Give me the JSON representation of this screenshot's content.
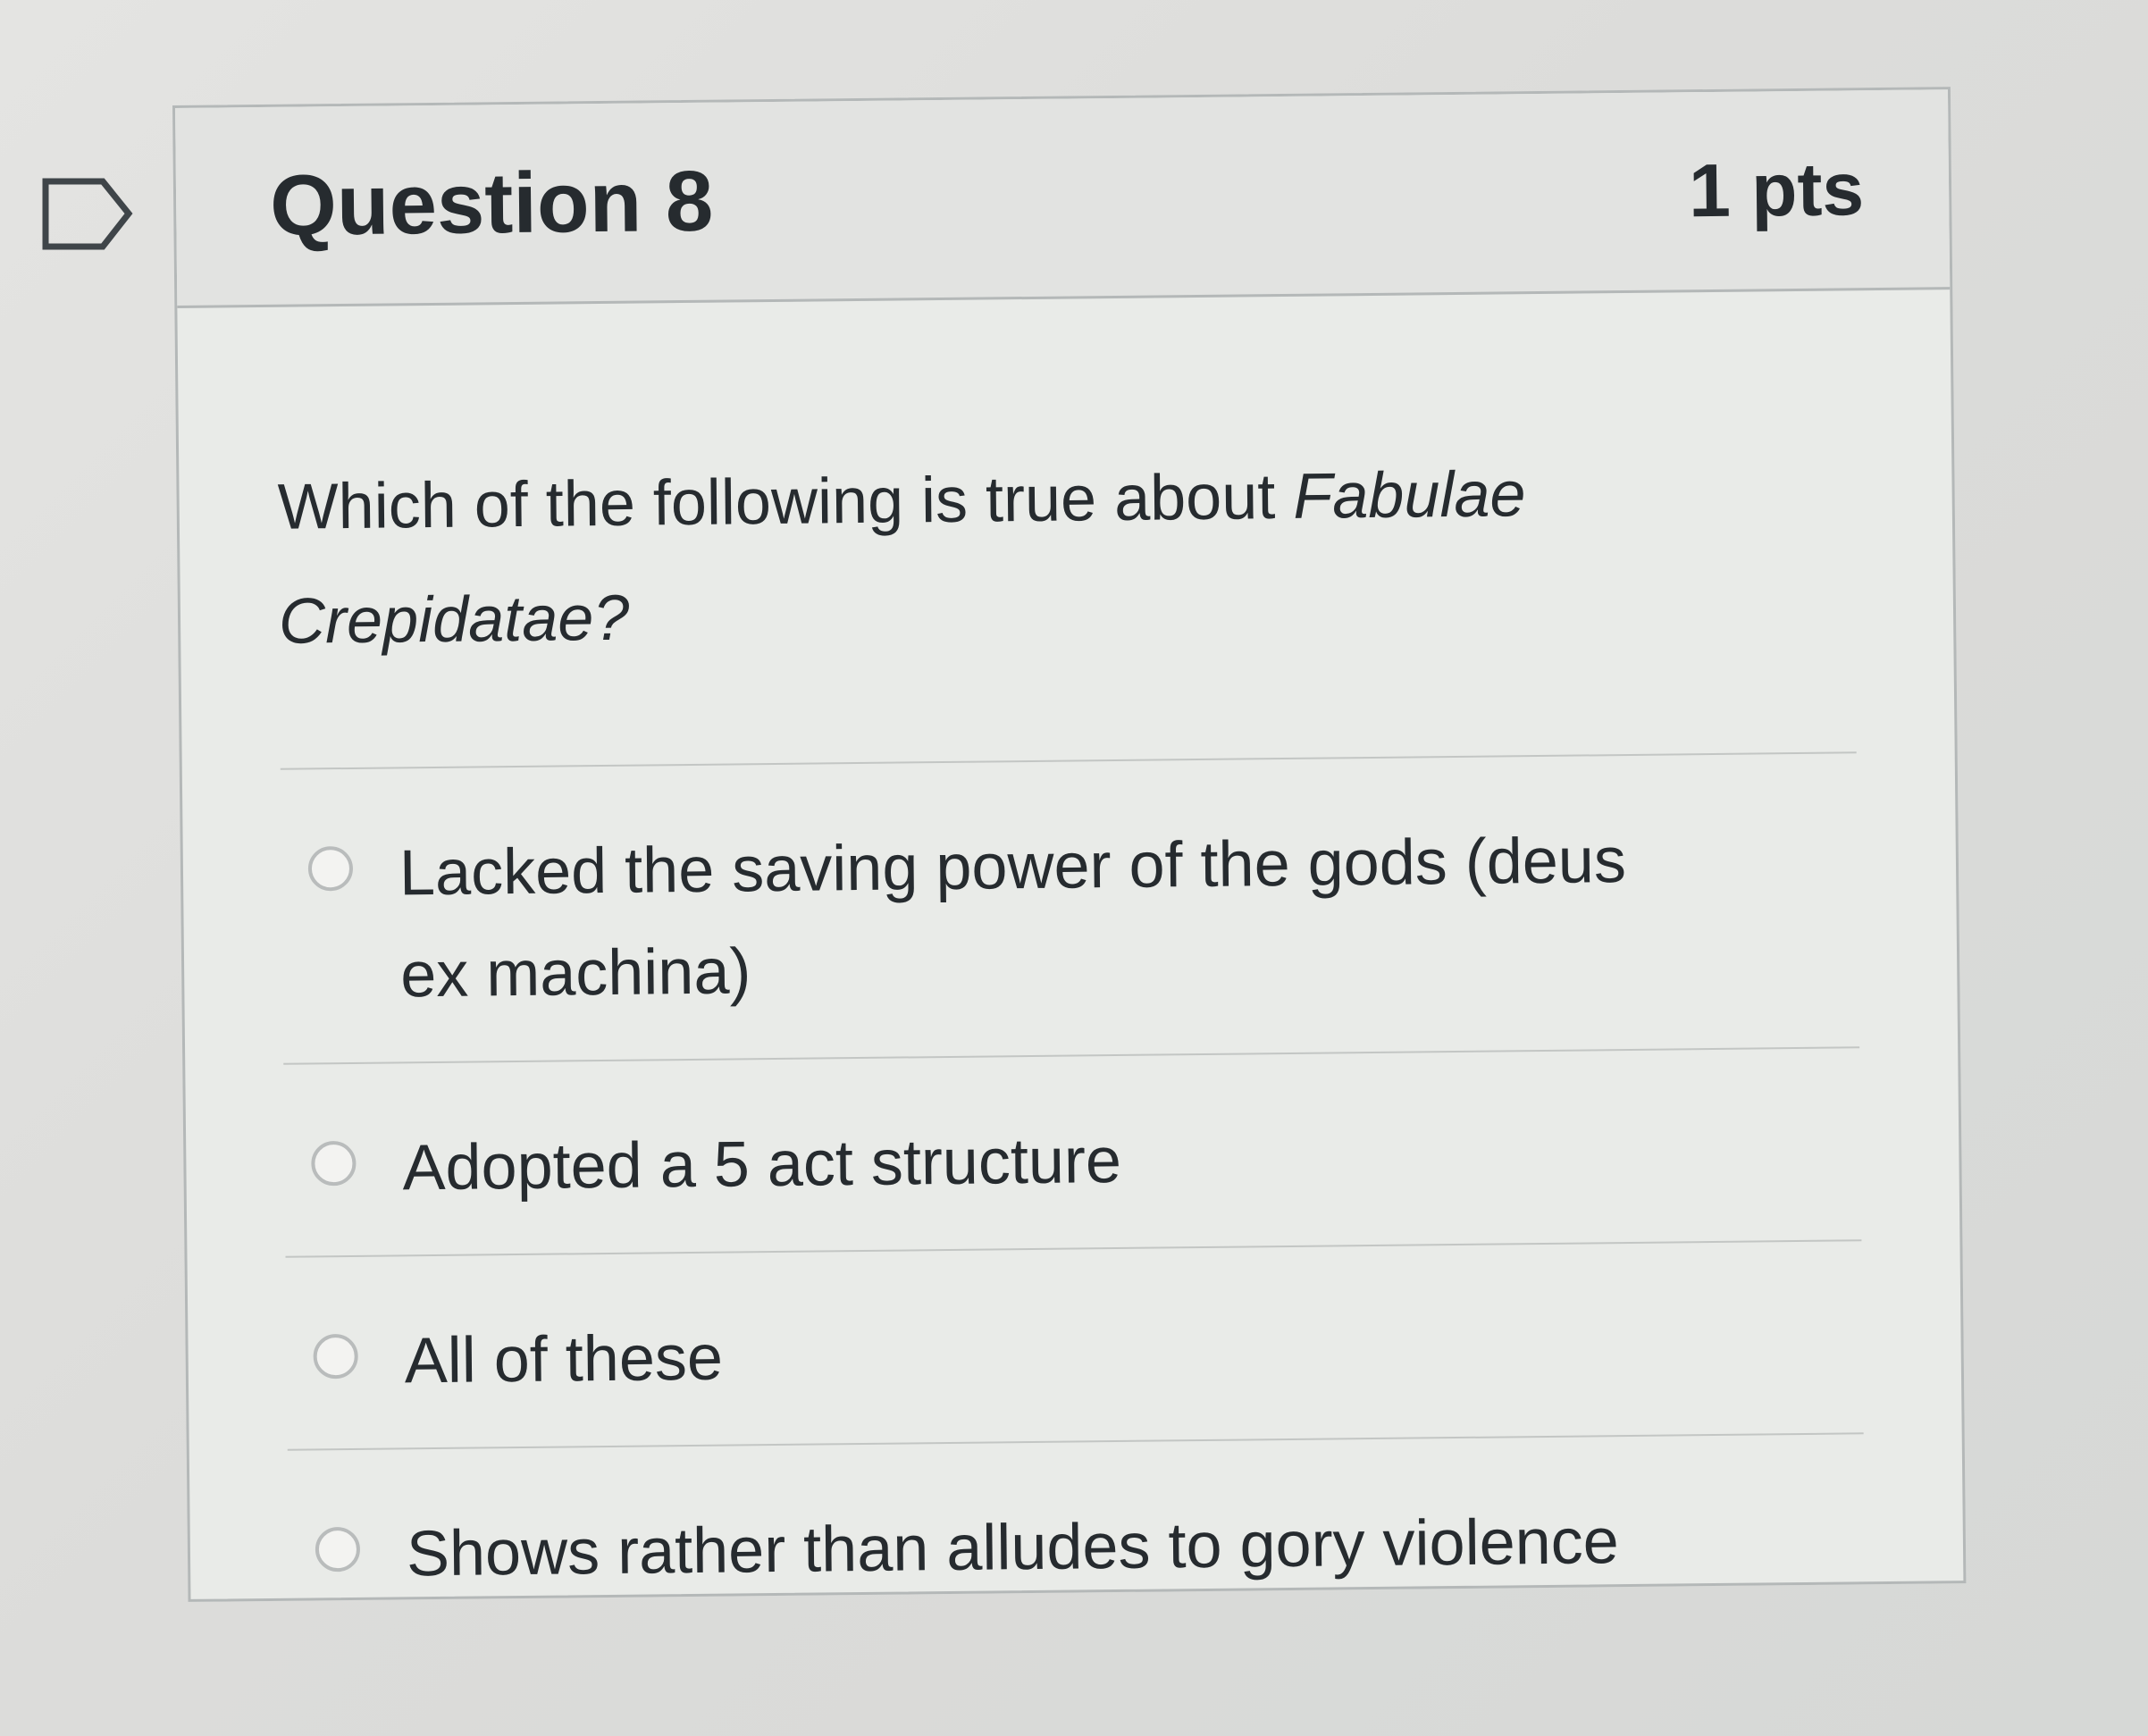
{
  "question": {
    "title": "Question 8",
    "points": "1 pts",
    "text_prefix": "Which of the following is true about ",
    "text_italic": "Fabulae Crepidatae?",
    "answers": [
      {
        "label": "Lacked the saving power of the gods (deus ex machina)"
      },
      {
        "label": "Adopted a 5 act structure"
      },
      {
        "label": "All of these"
      },
      {
        "label": "Shows rather than alludes to gory violence"
      }
    ]
  },
  "colors": {
    "text": "#262b2f",
    "border": "#b4b8b8",
    "header_bg": "#e2e3e1",
    "flag_outline": "#3f4549"
  },
  "icons": {
    "flag": "bookmark-flag-icon",
    "radio": "radio-unchecked-icon"
  }
}
